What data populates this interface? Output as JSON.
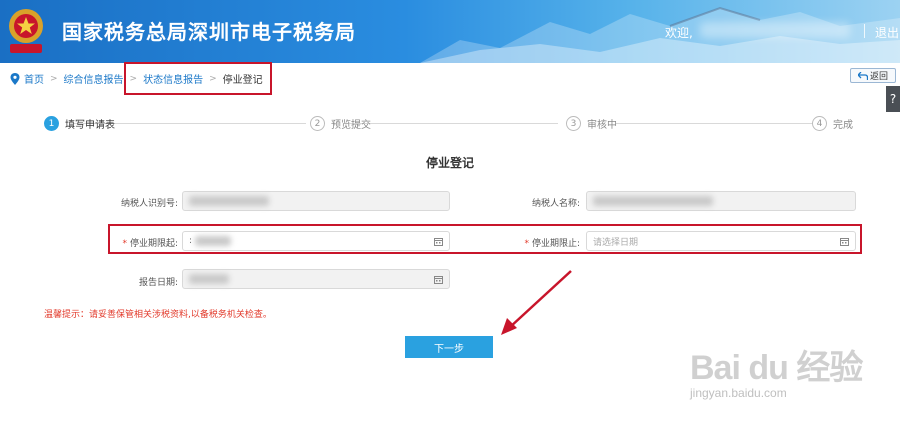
{
  "header": {
    "title": "国家税务总局深圳市电子税务局",
    "welcome": "欢迎,",
    "logout": "退出",
    "emblem_caption": "中国税务"
  },
  "breadcrumb": {
    "items": [
      "首页",
      "综合信息报告",
      "状态信息报告",
      "停业登记"
    ]
  },
  "back_button": {
    "label": "返回"
  },
  "help_tab": {
    "label": "?"
  },
  "steps": [
    {
      "num": "1",
      "label": "填写申请表",
      "active": true
    },
    {
      "num": "2",
      "label": "预览提交",
      "active": false
    },
    {
      "num": "3",
      "label": "审核中",
      "active": false
    },
    {
      "num": "4",
      "label": "完成",
      "active": false
    }
  ],
  "form": {
    "title": "停业登记",
    "taxpayer_id_label": "纳税人识别号:",
    "taxpayer_name_label": "纳税人名称:",
    "start_label": "停业期限起:",
    "end_label": "停业期限止:",
    "end_placeholder": "请选择日期",
    "report_date_label": "报告日期:",
    "start_prefix": ":"
  },
  "tip": "温馨提示：请妥善保管相关涉税资料,以备税务机关检查。",
  "next_button": {
    "label": "下一步"
  },
  "watermark": {
    "main": "Bai du 经验",
    "url": "jingyan.baidu.com"
  },
  "colors": {
    "primary": "#2aa1e0",
    "link": "#1b78c8",
    "highlight_box": "#c8152b",
    "required": "#e23a2b"
  }
}
